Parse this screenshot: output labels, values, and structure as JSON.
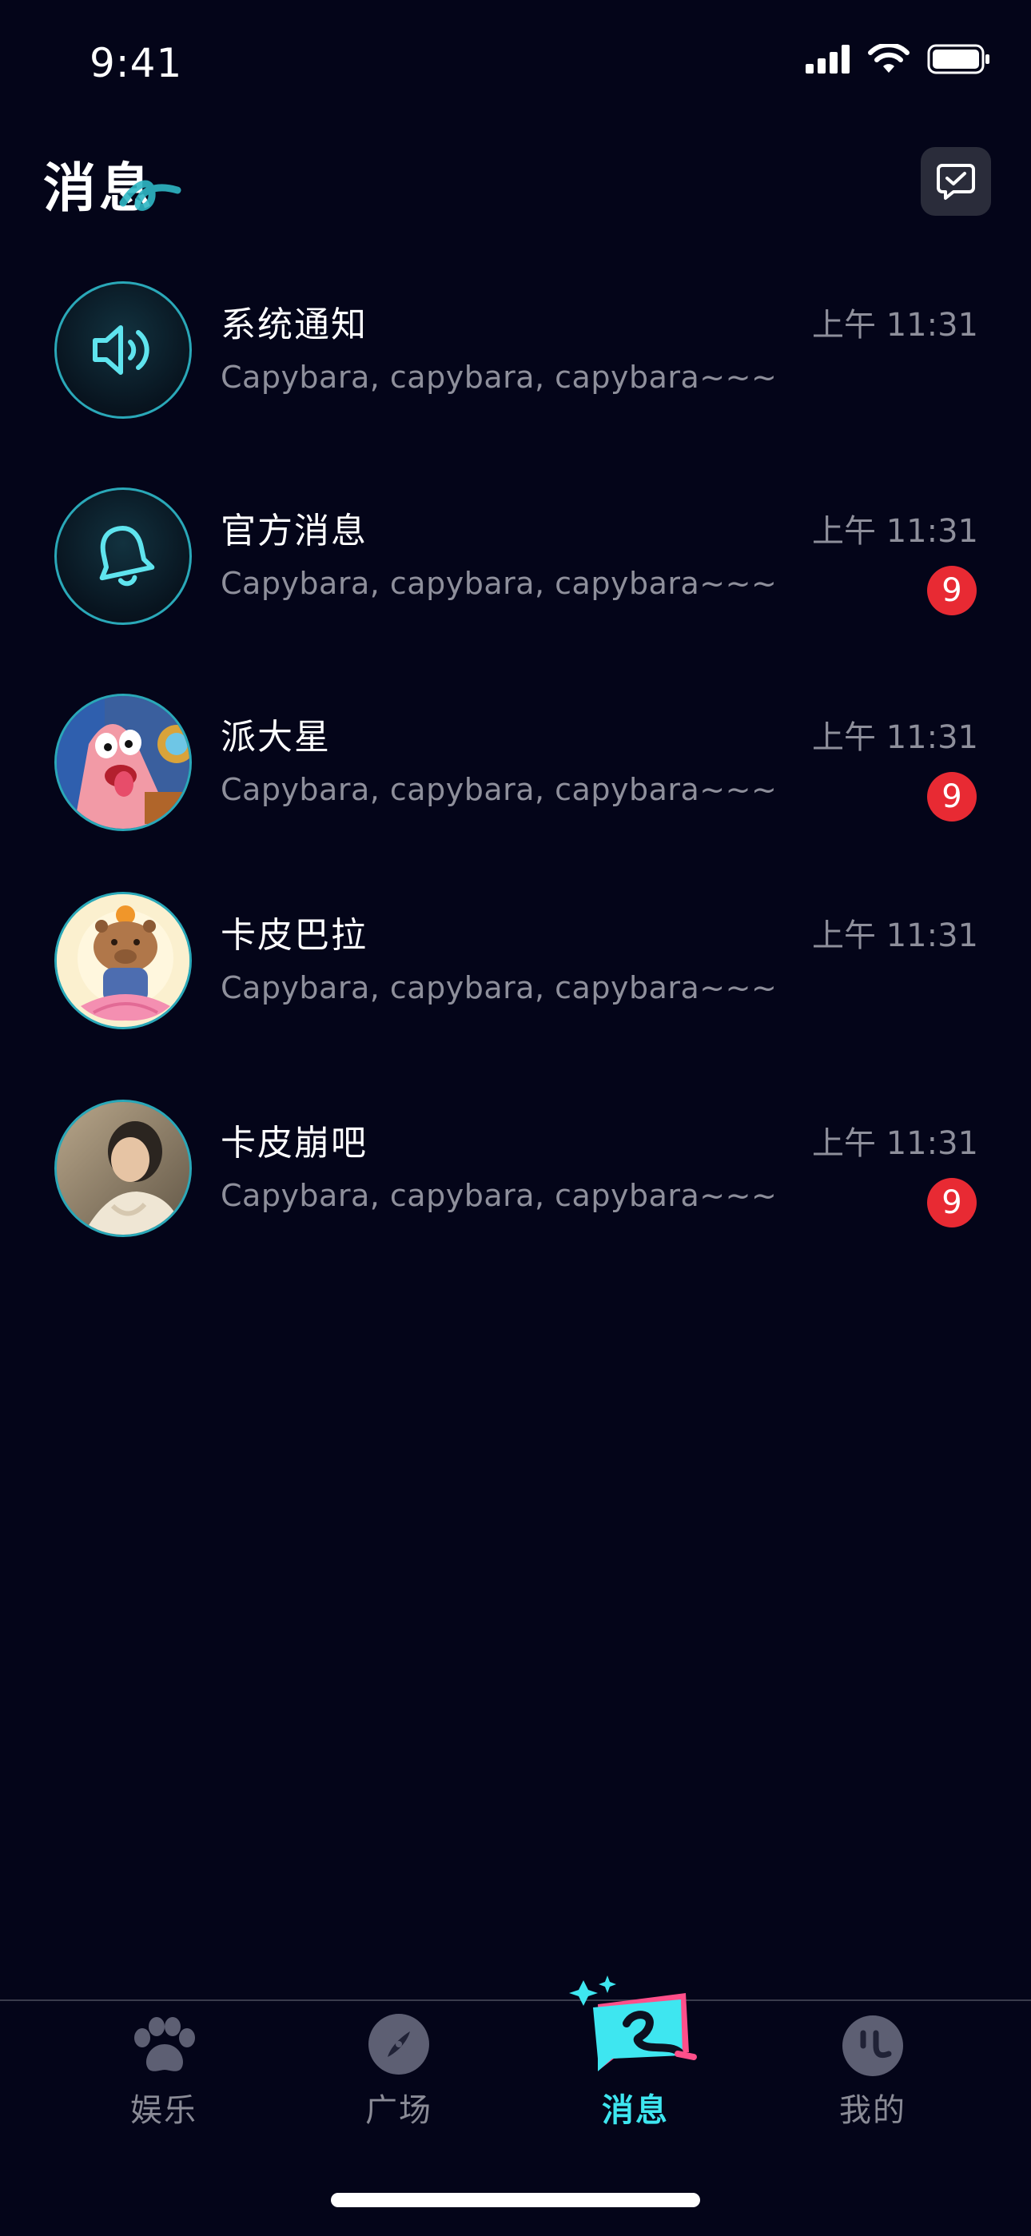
{
  "status_bar": {
    "time": "9:41"
  },
  "header": {
    "title": "消息"
  },
  "messages": [
    {
      "name": "系统通知",
      "preview": "Capybara, capybara, capybara~~~",
      "time": "上午 11:31",
      "unread": "",
      "avatar": "speaker-icon"
    },
    {
      "name": "官方消息",
      "preview": "Capybara, capybara, capybara~~~",
      "time": "上午 11:31",
      "unread": "9",
      "avatar": "bell-icon"
    },
    {
      "name": "派大星",
      "preview": "Capybara, capybara, capybara~~~",
      "time": "上午 11:31",
      "unread": "9",
      "avatar": "user-avatar"
    },
    {
      "name": "卡皮巴拉",
      "preview": "Capybara, capybara, capybara~~~",
      "time": "上午 11:31",
      "unread": "",
      "avatar": "user-avatar"
    },
    {
      "name": "卡皮崩吧",
      "preview": "Capybara, capybara, capybara~~~",
      "time": "上午 11:31",
      "unread": "9",
      "avatar": "user-avatar"
    }
  ],
  "tabs": [
    {
      "label": "娱乐",
      "icon": "paw-icon"
    },
    {
      "label": "广场",
      "icon": "compass-icon"
    },
    {
      "label": "消息",
      "icon": "message-icon",
      "active": true
    },
    {
      "label": "我的",
      "icon": "smile-icon"
    }
  ],
  "colors": {
    "accent": "#3ee6f0",
    "badge": "#e82a33",
    "background": "#040519"
  }
}
